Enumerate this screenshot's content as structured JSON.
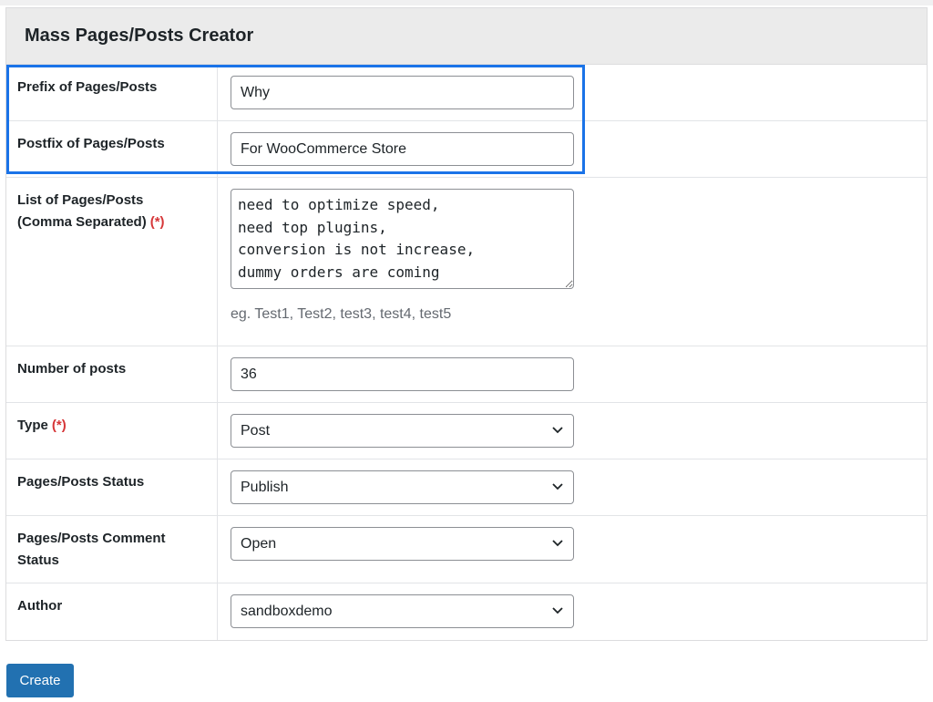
{
  "panel": {
    "title": "Mass Pages/Posts Creator"
  },
  "fields": {
    "prefix": {
      "label": "Prefix of Pages/Posts",
      "value": "Why"
    },
    "postfix": {
      "label": "Postfix of Pages/Posts",
      "value": "For WooCommerce Store"
    },
    "list": {
      "label_line1": "List of Pages/Posts",
      "label_line2": "(Comma Separated)",
      "required_mark": "(*)",
      "value": "need to optimize speed,\nneed top plugins,\nconversion is not increase,\ndummy orders are coming",
      "hint": "eg. Test1, Test2, test3, test4, test5"
    },
    "number": {
      "label": "Number of posts",
      "value": "36"
    },
    "type": {
      "label": "Type",
      "required_mark": "(*)",
      "selected": "Post"
    },
    "status": {
      "label": "Pages/Posts Status",
      "selected": "Publish"
    },
    "comment_status": {
      "label_line1": "Pages/Posts Comment",
      "label_line2": "Status",
      "selected": "Open"
    },
    "author": {
      "label": "Author",
      "selected": "sandboxdemo"
    }
  },
  "actions": {
    "create_label": "Create"
  },
  "colors": {
    "highlight": "#1a73e8",
    "button": "#2271b1",
    "required": "#d63638"
  },
  "icons": {
    "select_arrow": "chevron-down-icon"
  }
}
